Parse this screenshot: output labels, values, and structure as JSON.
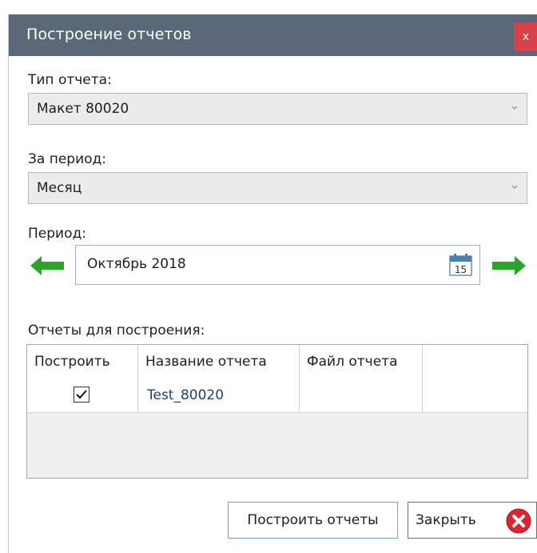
{
  "window": {
    "title": "Построение отчетов",
    "close_label": "x"
  },
  "report_type": {
    "label": "Тип отчета:",
    "value": "Макет 80020"
  },
  "period_type": {
    "label": "За период:",
    "value": "Месяц"
  },
  "period": {
    "label": "Период:",
    "value": "Октябрь 2018",
    "calendar_day": "15"
  },
  "reports": {
    "label": "Отчеты для построения:",
    "columns": [
      "Построить",
      "Название отчета",
      "Файл отчета"
    ],
    "rows": [
      {
        "build": true,
        "name": "Test_80020",
        "file": ""
      }
    ]
  },
  "buttons": {
    "build_label": "Построить отчеты",
    "close_label": "Закрыть"
  },
  "colors": {
    "titlebar": "#5b6877",
    "close_button": "#d8414a",
    "arrow_green": "#2aa52a",
    "link_text": "#1f3f7a"
  },
  "icons": {
    "prev_period": "arrow-left-icon",
    "next_period": "arrow-right-icon",
    "calendar": "calendar-icon",
    "close": "close-circle-icon"
  }
}
